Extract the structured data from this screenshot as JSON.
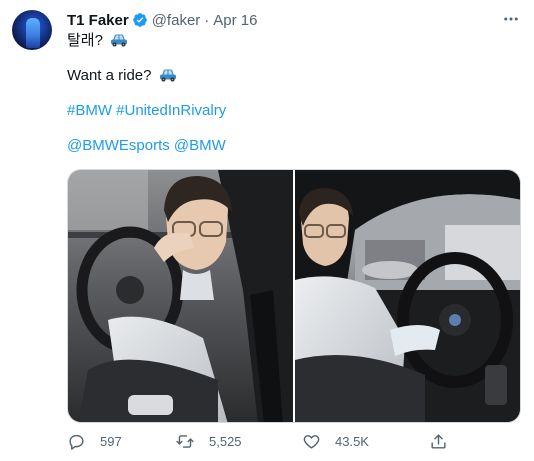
{
  "tweet": {
    "author_name": "T1 Faker",
    "handle": "@faker",
    "separator": "·",
    "date": "Apr 16",
    "line1": "탈래?",
    "line2": "Want a ride?",
    "hashtags": "#BMW #UnitedInRivalry",
    "mentions": "@BMWEsports @BMW",
    "emoji_icon": "car-icon"
  },
  "stats": {
    "replies": "597",
    "retweets": "5,525",
    "likes": "43.5K"
  },
  "icons": {
    "verified": "verified-badge-icon",
    "more": "more-options-icon",
    "reply": "reply-icon",
    "retweet": "retweet-icon",
    "like": "like-icon",
    "share": "share-icon"
  },
  "colors": {
    "accent": "#1d9bf0",
    "secondary_text": "#536471",
    "primary_text": "#0f1419"
  }
}
